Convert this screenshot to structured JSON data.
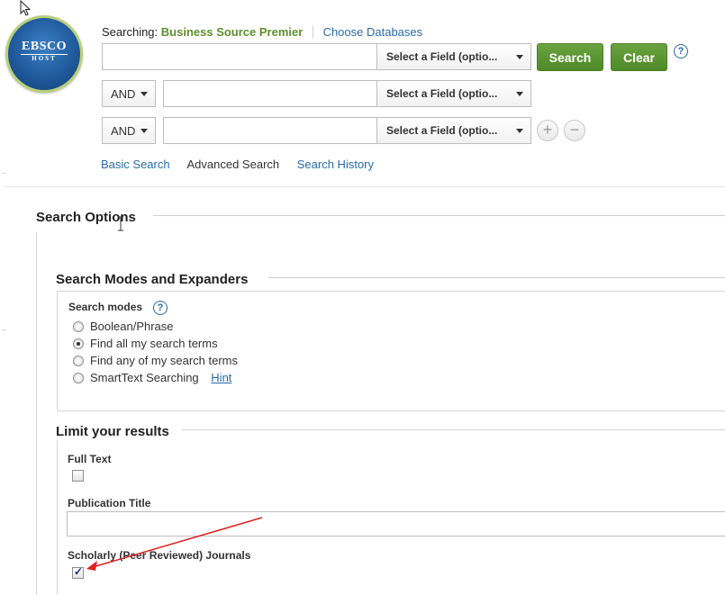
{
  "header": {
    "logo_text": "EBSCO",
    "logo_subtext": "HOST",
    "searching_label": "Searching:",
    "database_name": "Business Source Premier",
    "choose_databases": "Choose Databases"
  },
  "search": {
    "rows": [
      {
        "operator": "",
        "field_label": "Select a Field (optio..."
      },
      {
        "operator": "AND",
        "field_label": "Select a Field (optio..."
      },
      {
        "operator": "AND",
        "field_label": "Select a Field (optio..."
      }
    ],
    "search_button": "Search",
    "clear_button": "Clear",
    "help_icon": "?"
  },
  "nav_links": {
    "basic": "Basic Search",
    "advanced": "Advanced Search",
    "history": "Search History"
  },
  "search_options": {
    "title": "Search Options",
    "modes_section_title": "Search Modes and Expanders",
    "modes_label": "Search modes",
    "modes_help": "?",
    "modes": [
      {
        "label": "Boolean/Phrase",
        "selected": false
      },
      {
        "label": "Find all my search terms",
        "selected": true
      },
      {
        "label": "Find any of my search terms",
        "selected": false
      },
      {
        "label": "SmartText Searching",
        "selected": false
      }
    ],
    "hint_link": "Hint"
  },
  "limits": {
    "title": "Limit your results",
    "full_text_label": "Full Text",
    "full_text_checked": false,
    "publication_title_label": "Publication Title",
    "publication_title_value": "",
    "scholarly_label": "Scholarly (Peer Reviewed) Journals",
    "scholarly_checked": true
  },
  "colors": {
    "accent_green": "#5f8f2e",
    "link_blue": "#2a6ba8",
    "annotation_arrow": "#e02020"
  },
  "icons": {
    "add_row": "plus-icon",
    "remove_row": "minus-icon",
    "dropdown": "caret-down-icon"
  }
}
